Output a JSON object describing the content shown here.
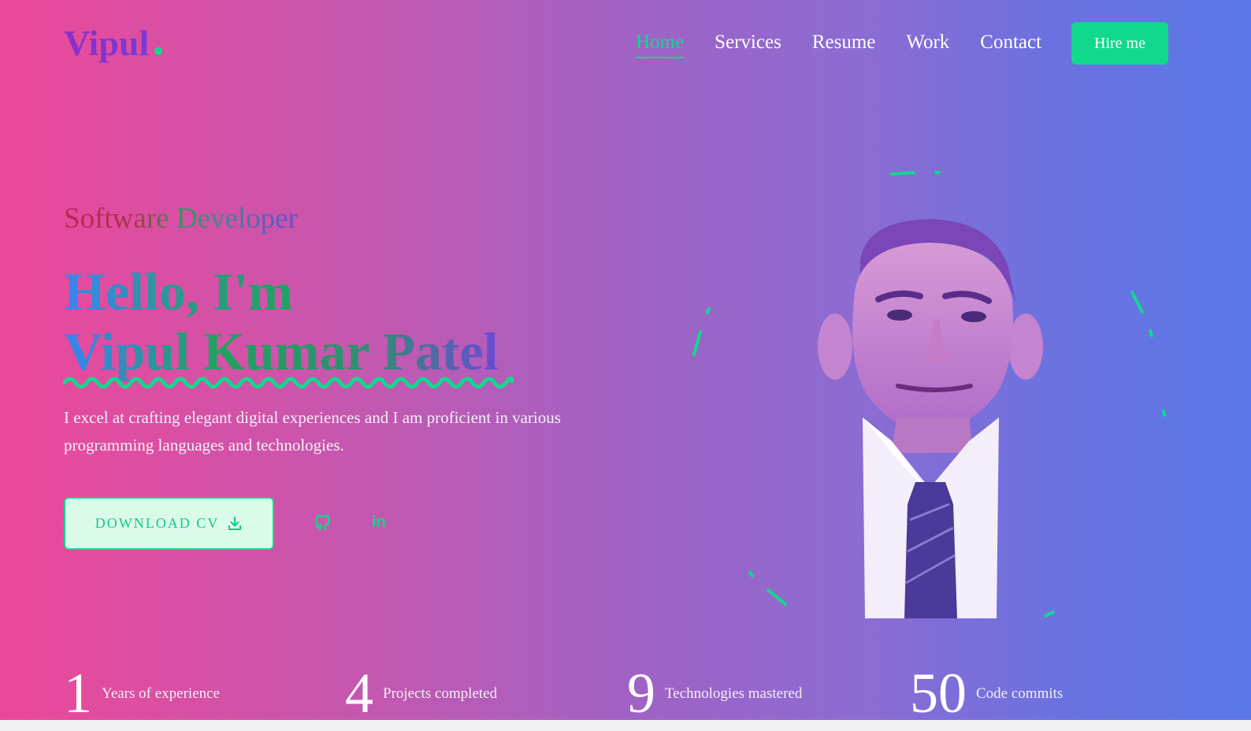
{
  "logo": {
    "text": "Vipul"
  },
  "nav": {
    "items": [
      "Home",
      "Services",
      "Resume",
      "Work",
      "Contact"
    ],
    "active": "Home",
    "hire_label": "Hire me"
  },
  "hero": {
    "subtitle": "Software Developer",
    "greeting": "Hello, I'm",
    "name": "Vipul Kumar Patel",
    "description": "I excel at crafting elegant digital experiences and I am proficient in various programming languages and technologies.",
    "download_label": "DOWNLOAD CV",
    "linkedin_label": "in"
  },
  "stats": [
    {
      "value": "1",
      "label": "Years of experience"
    },
    {
      "value": "4",
      "label": "Projects completed"
    },
    {
      "value": "9",
      "label": "Technologies mastered"
    },
    {
      "value": "50",
      "label": "Code commits"
    }
  ],
  "colors": {
    "accent": "#10d98d",
    "bg_left": "#ec4899",
    "bg_right": "#5b78e8"
  }
}
